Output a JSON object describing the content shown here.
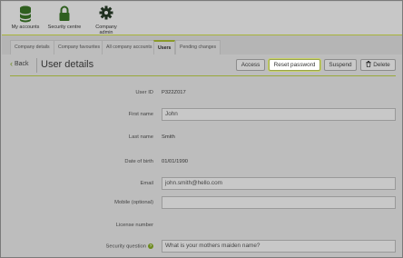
{
  "nav": {
    "items": [
      {
        "label": "My accounts",
        "icon": "database-icon"
      },
      {
        "label": "Security centre",
        "icon": "lock-icon"
      },
      {
        "label": "Company admin",
        "icon": "gear-icon"
      }
    ]
  },
  "tabs": [
    {
      "label": "Company details"
    },
    {
      "label": "Company favourites"
    },
    {
      "label": "All company accounts"
    },
    {
      "label": "Users"
    },
    {
      "label": "Pending changes"
    }
  ],
  "header": {
    "back_label": "Back",
    "title": "User details",
    "buttons": {
      "access": "Access",
      "reset_password": "Reset password",
      "suspend": "Suspend",
      "delete": "Delete"
    }
  },
  "form": {
    "user_id": {
      "label": "User ID",
      "value": "P322Z017"
    },
    "first_name": {
      "label": "First name",
      "value": "John"
    },
    "last_name": {
      "label": "Last name",
      "value": "Smith"
    },
    "dob": {
      "label": "Date of birth",
      "value": "01/01/1990"
    },
    "email": {
      "label": "Email",
      "value": "john.smith@hello.com"
    },
    "mobile": {
      "label": "Mobile (optional)",
      "value": ""
    },
    "license": {
      "label": "License number",
      "value": ""
    },
    "security_question": {
      "label": "Security question",
      "value": "What is your mothers maiden name?"
    }
  },
  "colors": {
    "accent": "#8a9a2a",
    "icon": "#2f5f1f",
    "overlay": "#8f8f8f"
  }
}
